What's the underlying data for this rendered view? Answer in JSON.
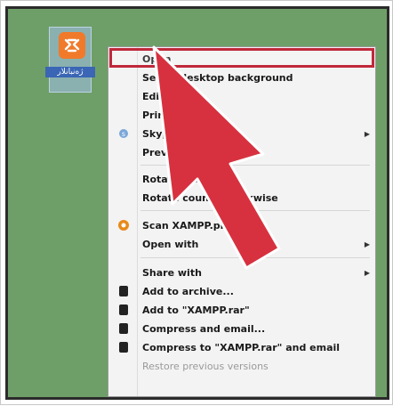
{
  "desktop": {
    "icon_label": "ژەنبانلار",
    "logo_glyph": "ꟷ"
  },
  "context_menu": {
    "items": [
      {
        "label": "Open",
        "arrow": ""
      },
      {
        "label": "Set as desktop background",
        "arrow": ""
      },
      {
        "label": "Edit",
        "arrow": ""
      },
      {
        "label": "Print",
        "arrow": ""
      },
      {
        "label": "Skype",
        "arrow": "▶"
      },
      {
        "label": "Preview",
        "arrow": ""
      },
      {
        "label": "Rotate clockwise",
        "arrow": ""
      },
      {
        "label": "Rotate counterclockwise",
        "arrow": ""
      },
      {
        "label": "Scan XAMPP.png",
        "arrow": ""
      },
      {
        "label": "Open with",
        "arrow": "▶"
      },
      {
        "label": "Share with",
        "arrow": "▶"
      },
      {
        "label": "Add to archive...",
        "arrow": ""
      },
      {
        "label": "Add to \"XAMPP.rar\"",
        "arrow": ""
      },
      {
        "label": "Compress and email...",
        "arrow": ""
      },
      {
        "label": "Compress to \"XAMPP.rar\" and email",
        "arrow": ""
      },
      {
        "label": "Restore previous versions",
        "arrow": ""
      }
    ]
  },
  "colors": {
    "highlight_border": "#c0283a",
    "pointer_fill": "#d7313f",
    "pointer_outline": "#ffffff",
    "desktop_bg": "#6f9f68",
    "xampp_orange": "#f07a2a"
  }
}
